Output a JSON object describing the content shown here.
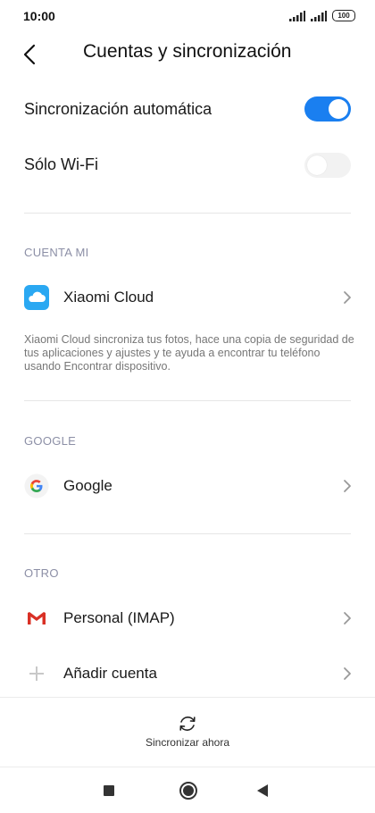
{
  "status_bar": {
    "time": "10:00",
    "battery": "100"
  },
  "header": {
    "title": "Cuentas y sincronización"
  },
  "settings": {
    "auto_sync": {
      "label": "Sincronización automática",
      "enabled": true
    },
    "wifi_only": {
      "label": "Sólo Wi-Fi",
      "enabled": false
    }
  },
  "sections": {
    "mi_account": {
      "header": "CUENTA MI",
      "item_label": "Xiaomi Cloud",
      "description": "Xiaomi Cloud sincroniza tus fotos, hace una copia de seguridad de tus aplicaciones y ajustes y te ayuda a encontrar tu teléfono usando Encontrar dispositivo."
    },
    "google": {
      "header": "GOOGLE",
      "item_label": "Google"
    },
    "other": {
      "header": "OTRO",
      "items": [
        {
          "label": "Personal (IMAP)",
          "icon": "gmail-icon"
        },
        {
          "label": "Añadir cuenta",
          "icon": "plus-icon"
        }
      ]
    }
  },
  "sync_now": {
    "label": "Sincronizar ahora"
  },
  "colors": {
    "accent": "#1a7ff0",
    "section_header": "#8c8fa6"
  }
}
